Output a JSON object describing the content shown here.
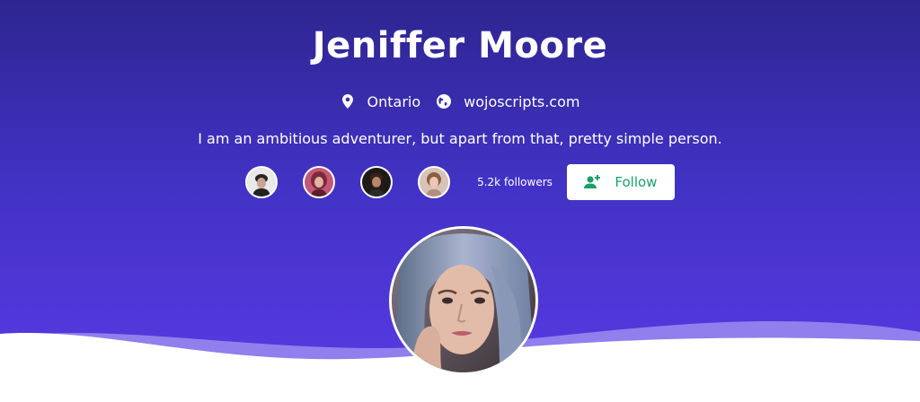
{
  "profile": {
    "name": "Jeniffer Moore",
    "location": "Ontario",
    "website": "wojoscripts.com",
    "bio": "I am an ambitious adventurer, but apart from that, pretty simple person.",
    "followers_label": "5.2k followers",
    "follow_label": "Follow"
  },
  "icons": {
    "location": "map-pin-icon",
    "website": "globe-icon",
    "follow": "user-plus-icon"
  },
  "colors": {
    "hero_top": "#2d2590",
    "hero_bottom": "#5a3ae6",
    "wave_back": "#9b8cf0",
    "follow_text": "#1aa06b"
  }
}
